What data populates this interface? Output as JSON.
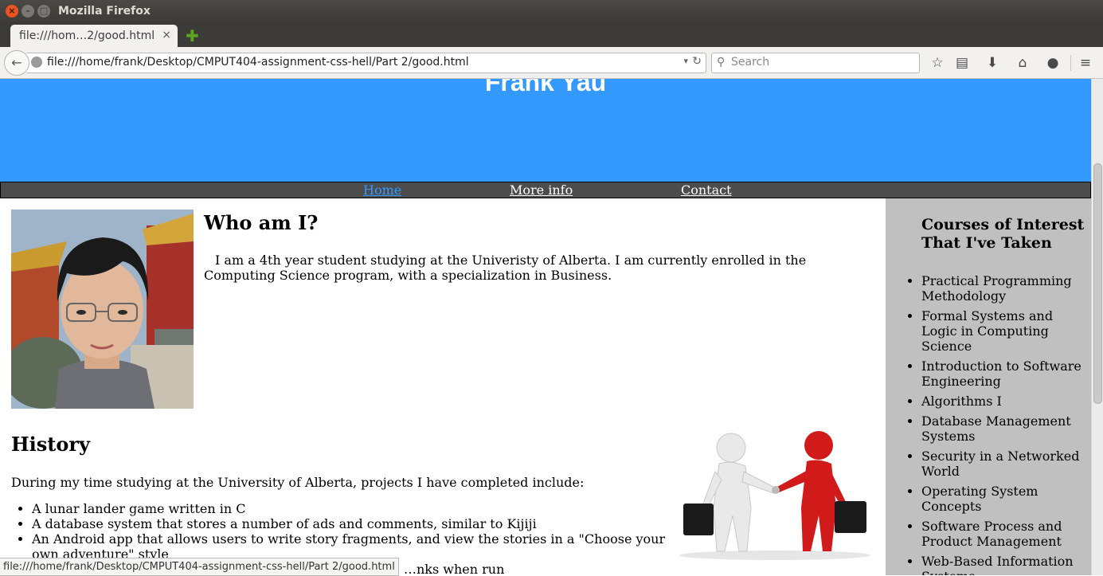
{
  "window": {
    "title": "Mozilla Firefox"
  },
  "tab": {
    "label": "file:///hom…2/good.html",
    "close": "×",
    "new_tab": "✚"
  },
  "navbar": {
    "url": "file:///home/frank/Desktop/CMPUT404-assignment-css-hell/Part 2/good.html",
    "search_placeholder": "Search"
  },
  "site": {
    "title": "Frank Yau",
    "nav": {
      "home": "Home",
      "more_info": "More info",
      "contact": "Contact"
    },
    "who": {
      "heading": "Who am I?",
      "text": "I am a 4th year student studying at the Univeristy of Alberta. I am currently enrolled in the Computing Science program, with a specialization in Business."
    },
    "history": {
      "heading": "History",
      "intro": "During my time studying at the University of Alberta, projects I have completed include:",
      "items": [
        "A lunar lander game written in C",
        "A database system that stores a number of ads and comments, similar to Kijiji",
        "An Android app that allows users to write story fragments, and view the stories in a \"Choose your own adventure\" style",
        "…nks when run"
      ]
    },
    "sidebar": {
      "title": "Courses of Interest That I've Taken",
      "courses": [
        "Practical Programming Methodology",
        "Formal Systems and Logic in Computing Science",
        "Introduction to Software Engineering",
        "Algorithms I",
        "Database Management Systems",
        "Security in a Networked World",
        "Operating System Concepts",
        "Software Process and Product Management",
        "Web-Based Information Systems"
      ]
    }
  },
  "status_bar": {
    "text": "file:///home/frank/Desktop/CMPUT404-assignment-css-hell/Part 2/good.html"
  },
  "colors": {
    "header_blue": "#3399ff",
    "nav_bg": "#4c4c4c",
    "sidebar_bg": "#c0c0c0"
  }
}
